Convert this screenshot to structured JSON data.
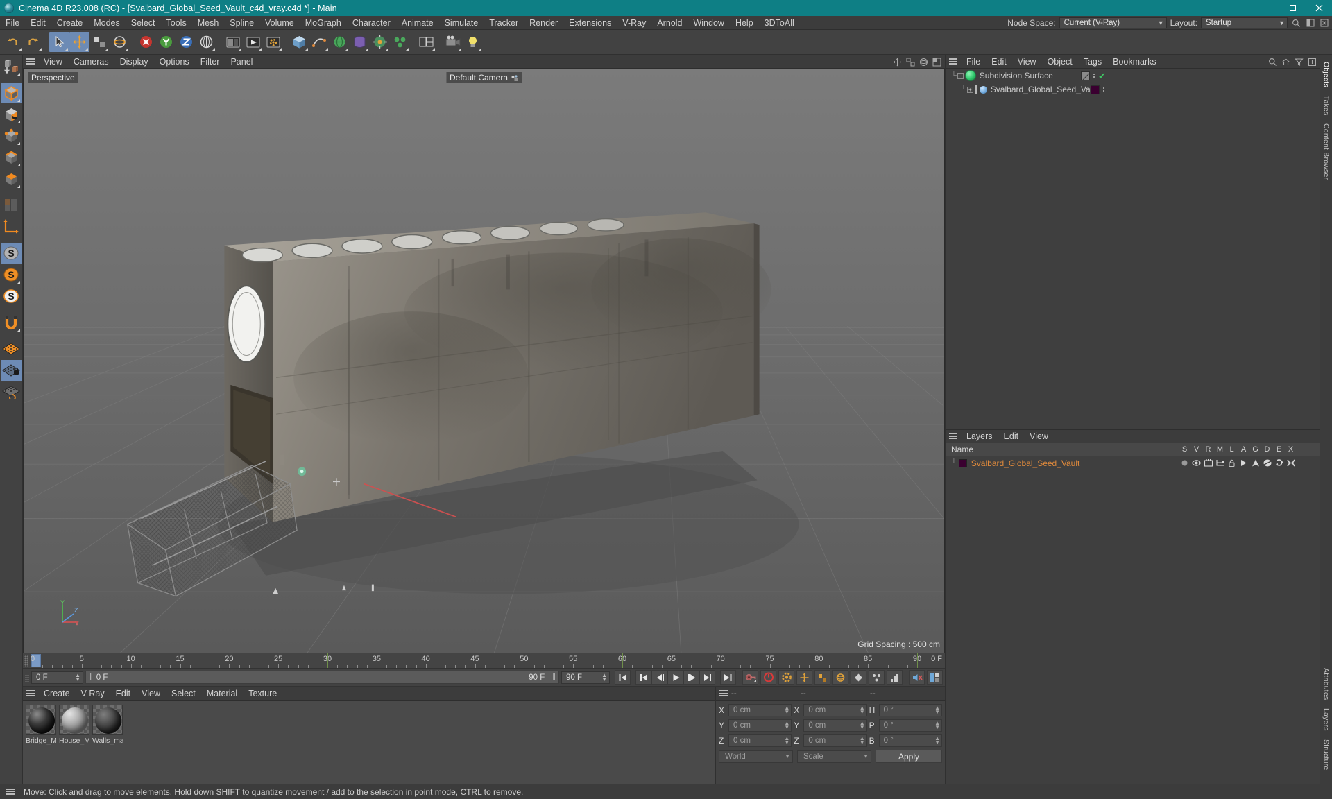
{
  "window": {
    "title": "Cinema 4D R23.008 (RC) - [Svalbard_Global_Seed_Vault_c4d_vray.c4d *] - Main",
    "minimize": "−",
    "maximize": "▢",
    "close": "✕"
  },
  "menubar": {
    "items": [
      {
        "label": "File"
      },
      {
        "label": "Edit"
      },
      {
        "label": "Create"
      },
      {
        "label": "Modes"
      },
      {
        "label": "Select"
      },
      {
        "label": "Tools"
      },
      {
        "label": "Mesh"
      },
      {
        "label": "Spline"
      },
      {
        "label": "Volume"
      },
      {
        "label": "MoGraph"
      },
      {
        "label": "Character"
      },
      {
        "label": "Animate"
      },
      {
        "label": "Simulate"
      },
      {
        "label": "Tracker"
      },
      {
        "label": "Render"
      },
      {
        "label": "Extensions"
      },
      {
        "label": "V-Ray"
      },
      {
        "label": "Arnold"
      },
      {
        "label": "Window"
      },
      {
        "label": "Help"
      },
      {
        "label": "3DToAll"
      }
    ],
    "node_space_label": "Node Space:",
    "node_space_value": "Current (V-Ray)",
    "layout_label": "Layout:",
    "layout_value": "Startup",
    "search_icon": "search-icon"
  },
  "toolbar": {
    "buttons": [
      {
        "name": "undo-button",
        "icon": "undo-arrow"
      },
      {
        "name": "redo-button",
        "icon": "redo-arrow"
      },
      {
        "name": "live-selection-tool",
        "icon": "cursor-arrow",
        "active": true
      },
      {
        "name": "move-tool",
        "icon": "move-axes",
        "active": true
      },
      {
        "name": "scale-tool",
        "icon": "scale-box"
      },
      {
        "name": "rotate-tool",
        "icon": "rotate-circle"
      },
      {
        "name": "axis-lock-x",
        "icon": "x-axis-lock"
      },
      {
        "name": "axis-lock-y",
        "icon": "y-axis-lock"
      },
      {
        "name": "axis-lock-z",
        "icon": "z-axis-lock"
      },
      {
        "name": "world-object-coordinate",
        "icon": "world-coordinate"
      },
      {
        "name": "render-view-button",
        "icon": "render-view"
      },
      {
        "name": "render-to-picture-viewer",
        "icon": "render-picture"
      },
      {
        "name": "render-settings-button",
        "icon": "render-settings"
      },
      {
        "name": "cube-primitive",
        "icon": "cube"
      },
      {
        "name": "spline-pen",
        "icon": "spline-pen"
      },
      {
        "name": "generators",
        "icon": "generator-sphere"
      },
      {
        "name": "deformers",
        "icon": "deformer-box"
      },
      {
        "name": "scene-environment",
        "icon": "environment"
      },
      {
        "name": "camera-object",
        "icon": "camera"
      },
      {
        "name": "light-object",
        "icon": "light-bulb"
      }
    ]
  },
  "left_tools": {
    "buttons": [
      {
        "name": "make-editable-tool",
        "icon": "make-editable"
      },
      {
        "name": "model-mode",
        "icon": "model-cube",
        "active": true
      },
      {
        "name": "texture-mode",
        "icon": "texture-cube"
      },
      {
        "name": "point-mode",
        "icon": "points-cube"
      },
      {
        "name": "edge-mode",
        "icon": "edge-cube"
      },
      {
        "name": "polygon-mode",
        "icon": "polygon-cube"
      },
      {
        "name": "uv-polygon-mode",
        "icon": "uv-polygon"
      },
      {
        "name": "workplane-mode",
        "icon": "axis-origin"
      },
      {
        "name": "enable-snap",
        "icon": "snap-s-gray",
        "active": true
      },
      {
        "name": "snap-settings",
        "icon": "snap-s-orange"
      },
      {
        "name": "quantize-snap",
        "icon": "snap-s-white"
      },
      {
        "name": "magnet-tool",
        "icon": "magnet"
      },
      {
        "name": "workplane-grid",
        "icon": "grid-orange"
      },
      {
        "name": "lock-workplane",
        "icon": "grid-lock",
        "active": true
      },
      {
        "name": "planar-workplane",
        "icon": "grid-rotate"
      }
    ]
  },
  "viewport": {
    "menu": [
      {
        "label": "View"
      },
      {
        "label": "Cameras"
      },
      {
        "label": "Display"
      },
      {
        "label": "Options"
      },
      {
        "label": "Filter"
      },
      {
        "label": "Panel"
      }
    ],
    "label": "Perspective",
    "camera": "Default Camera",
    "grid_spacing": "Grid Spacing : 500 cm",
    "axis": {
      "x": "X",
      "y": "Y",
      "z": "Z"
    },
    "right_icons": [
      "move-viewport-icon",
      "scale-viewport-icon",
      "rotate-viewport-icon",
      "maximize-viewport-icon"
    ]
  },
  "timeline": {
    "ticks": [
      {
        "value": "0",
        "frame": 0
      },
      {
        "value": "5",
        "frame": 5
      },
      {
        "value": "10",
        "frame": 10
      },
      {
        "value": "15",
        "frame": 15
      },
      {
        "value": "20",
        "frame": 20
      },
      {
        "value": "25",
        "frame": 25
      },
      {
        "value": "30",
        "frame": 30
      },
      {
        "value": "35",
        "frame": 35
      },
      {
        "value": "40",
        "frame": 40
      },
      {
        "value": "45",
        "frame": 45
      },
      {
        "value": "50",
        "frame": 50
      },
      {
        "value": "55",
        "frame": 55
      },
      {
        "value": "60",
        "frame": 60
      },
      {
        "value": "65",
        "frame": 65
      },
      {
        "value": "70",
        "frame": 70
      },
      {
        "value": "75",
        "frame": 75
      },
      {
        "value": "80",
        "frame": 80
      },
      {
        "value": "85",
        "frame": 85
      },
      {
        "value": "90",
        "frame": 90
      }
    ],
    "range_start": 0,
    "range_end": 90,
    "current_frame_field": "0 F",
    "current_frame_track": "0 F",
    "end_frame_readout": "90 F",
    "end_frame_field": "90 F",
    "right_top_field": "0 F",
    "transport": [
      {
        "name": "go-to-start-button",
        "icon": "skip-start"
      },
      {
        "name": "go-to-previous-key",
        "icon": "prev-key"
      },
      {
        "name": "step-back-button",
        "icon": "step-back"
      },
      {
        "name": "play-button",
        "icon": "play"
      },
      {
        "name": "step-forward-button",
        "icon": "step-forward"
      },
      {
        "name": "go-to-next-key",
        "icon": "next-key"
      },
      {
        "name": "go-to-end-button",
        "icon": "skip-end"
      }
    ],
    "record_tools": [
      {
        "name": "autokey-button",
        "icon": "key-red"
      },
      {
        "name": "record-button",
        "icon": "record-circle"
      },
      {
        "name": "keyframe-settings",
        "icon": "gear-orange"
      },
      {
        "name": "position-key",
        "icon": "position-key"
      },
      {
        "name": "scale-key",
        "icon": "scale-key"
      },
      {
        "name": "rotation-key",
        "icon": "rotation-key"
      },
      {
        "name": "param-key",
        "icon": "param-key"
      },
      {
        "name": "pla-key",
        "icon": "pla-key"
      },
      {
        "name": "point-level-anim",
        "icon": "point-anim"
      },
      {
        "name": "sound-button",
        "icon": "speaker-mute"
      },
      {
        "name": "timeline-layout-button",
        "icon": "layout-bars"
      }
    ]
  },
  "materials": {
    "menu": [
      {
        "label": "Create"
      },
      {
        "label": "V-Ray"
      },
      {
        "label": "Edit"
      },
      {
        "label": "View"
      },
      {
        "label": "Select"
      },
      {
        "label": "Material"
      },
      {
        "label": "Texture"
      }
    ],
    "items": [
      {
        "name": "Bridge_M",
        "full_name": "Bridge_Material",
        "color": "#2a2a2a"
      },
      {
        "name": "House_M",
        "full_name": "House_Material",
        "color": "#8d8d8d"
      },
      {
        "name": "Walls_ma",
        "full_name": "Walls_material",
        "color": "#3c3c3c"
      }
    ]
  },
  "coordinates": {
    "header": [
      "--",
      "--",
      "--"
    ],
    "rows": [
      {
        "label1": "X",
        "value1": "0 cm",
        "label2": "X",
        "value2": "0 cm",
        "label3": "H",
        "value3": "0 °"
      },
      {
        "label1": "Y",
        "value1": "0 cm",
        "label2": "Y",
        "value2": "0 cm",
        "label3": "P",
        "value3": "0 °"
      },
      {
        "label1": "Z",
        "value1": "0 cm",
        "label2": "Z",
        "value2": "0 cm",
        "label3": "B",
        "value3": "0 °"
      }
    ],
    "system": "World",
    "mode": "Scale",
    "apply": "Apply"
  },
  "objects_panel": {
    "menu": [
      {
        "label": "File"
      },
      {
        "label": "Edit"
      },
      {
        "label": "View"
      },
      {
        "label": "Object"
      },
      {
        "label": "Tags"
      },
      {
        "label": "Bookmarks"
      }
    ],
    "icons": [
      "search-icon",
      "home-icon",
      "filter-icon",
      "add-icon"
    ],
    "tree": [
      {
        "name": "Subdivision Surface",
        "depth": 0,
        "icon_color": "#3fe07f",
        "has_children": true,
        "tag_color": "#6e6e6e",
        "checked": true
      },
      {
        "name": "Svalbard_Global_Seed_Vault",
        "depth": 1,
        "icon_color": "#7eb6e8",
        "has_children": true,
        "tag_color": "#3a0030",
        "checked": false
      }
    ]
  },
  "layers_panel": {
    "menu": [
      {
        "label": "Layers"
      },
      {
        "label": "Edit"
      },
      {
        "label": "View"
      }
    ],
    "columns": [
      "S",
      "V",
      "R",
      "M",
      "L",
      "A",
      "G",
      "D",
      "E",
      "X"
    ],
    "name_header": "Name",
    "rows": [
      {
        "name": "Svalbard_Global_Seed_Vault",
        "color": "#3a0030",
        "text_color": "#e08a3c"
      }
    ]
  },
  "right_tabs": [
    {
      "label": "Objects",
      "active": true
    },
    {
      "label": "Takes",
      "active": false
    },
    {
      "label": "Content Browser",
      "active": false
    },
    {
      "label": "Attributes",
      "active": false
    },
    {
      "label": "Layers",
      "active": false
    },
    {
      "label": "Structure",
      "active": false
    }
  ],
  "statusbar": {
    "message": "Move: Click and drag to move elements. Hold down SHIFT to quantize movement / add to the selection in point mode, CTRL to remove."
  },
  "colors": {
    "titlebar": "#0e7f85",
    "accent_orange": "#e08a3c",
    "panel_bg": "#3c3c3c",
    "active_blue": "#6d8bb5"
  }
}
